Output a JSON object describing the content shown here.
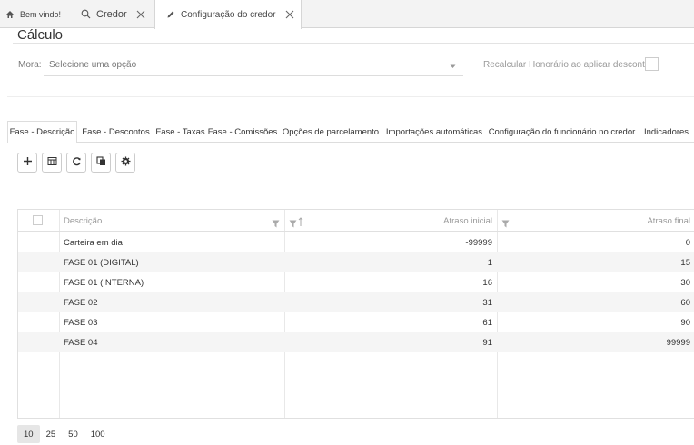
{
  "top_tabs": [
    {
      "label": "Bem vindo!",
      "icon": "home-icon"
    },
    {
      "label": "Credor",
      "icon": "search-icon"
    },
    {
      "label": "Configuração do credor",
      "icon": "pencil-icon"
    }
  ],
  "section": {
    "title": "Cálculo"
  },
  "mora": {
    "label": "Mora:",
    "placeholder": "Selecione uma opção"
  },
  "recalcular": {
    "label": "Recalcular Honorário ao aplicar descontos:",
    "checked": false
  },
  "sub_tabs": [
    "Fase - Descrição",
    "Fase - Descontos",
    "Fase - Taxas",
    "Fase - Comissões",
    "Opções de parcelamento",
    "Importações automáticas",
    "Configuração do funcionário no credor",
    "Indicadores"
  ],
  "toolbar": [
    "add-icon",
    "export-icon",
    "refresh-icon",
    "copy-icon",
    "settings-icon"
  ],
  "grid": {
    "columns": [
      "Descrição",
      "Atraso inicial",
      "Atraso final"
    ],
    "rows": [
      {
        "descricao": "Carteira em dia",
        "inicial": "-99999",
        "final": "0"
      },
      {
        "descricao": "FASE 01 (DIGITAL)",
        "inicial": "1",
        "final": "15"
      },
      {
        "descricao": "FASE 01 (INTERNA)",
        "inicial": "16",
        "final": "30"
      },
      {
        "descricao": "FASE 02",
        "inicial": "31",
        "final": "60"
      },
      {
        "descricao": "FASE 03",
        "inicial": "61",
        "final": "90"
      },
      {
        "descricao": "FASE 04",
        "inicial": "91",
        "final": "99999"
      }
    ]
  },
  "pager": {
    "sizes": [
      "10",
      "25",
      "50",
      "100"
    ],
    "selected": "10"
  }
}
